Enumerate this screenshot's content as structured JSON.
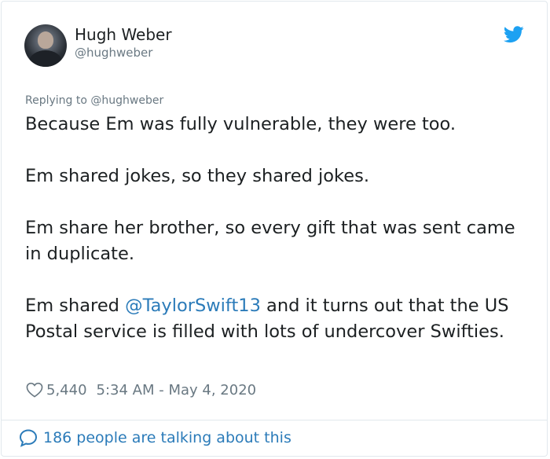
{
  "author": {
    "name": "Hugh Weber",
    "handle": "@hughweber"
  },
  "reply_to": "Replying to @hughweber",
  "tweet": {
    "para1": "Because Em was fully vulnerable, they were too.",
    "para2": "Em shared jokes, so they shared jokes.",
    "para3": "Em share her brother, so every gift that was sent came in duplicate.",
    "para4_before": "Em shared ",
    "para4_mention": "@TaylorSwift13",
    "para4_after": " and it turns out that the US Postal service is filled with lots of undercover Swifties."
  },
  "stats": {
    "likes": "5,440",
    "timestamp": "5:34 AM - May 4, 2020"
  },
  "footer": {
    "talking": "186 people are talking about this"
  },
  "icons": {
    "brand": "twitter-bird-icon",
    "like": "heart-icon",
    "conversation": "speech-bubble-icon"
  },
  "colors": {
    "brand": "#1da1f2",
    "link": "#2b7bb9",
    "muted": "#697882",
    "text": "#1c2022"
  }
}
